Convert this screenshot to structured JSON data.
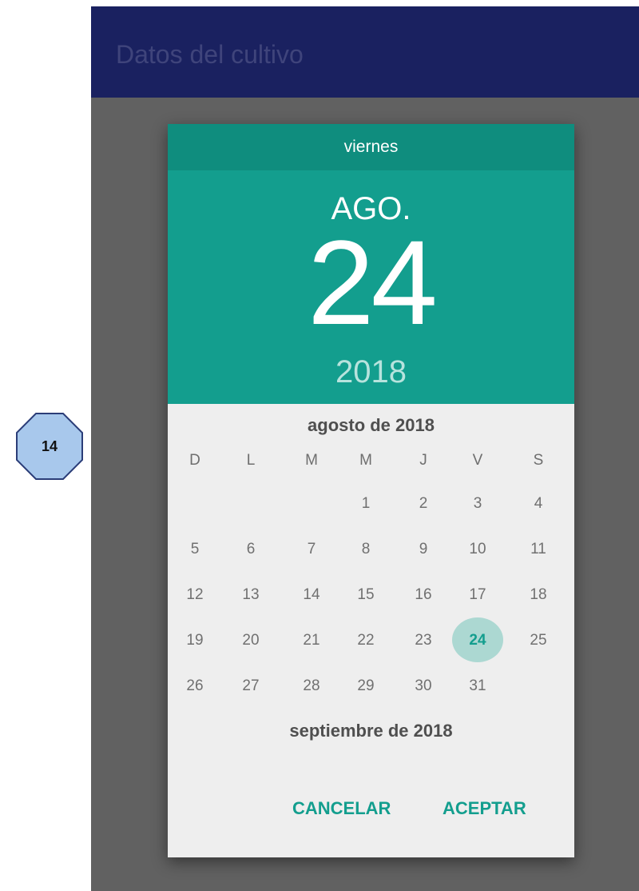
{
  "app": {
    "title": "Datos del cultivo"
  },
  "step_marker": {
    "label": "14"
  },
  "date_picker": {
    "weekday": "viernes",
    "month_short": "AGO.",
    "day": "24",
    "year": "2018",
    "month_title": "agosto de 2018",
    "weekday_headers": [
      "D",
      "L",
      "M",
      "M",
      "J",
      "V",
      "S"
    ],
    "weeks": [
      [
        "",
        "",
        "",
        "1",
        "2",
        "3",
        "4"
      ],
      [
        "5",
        "6",
        "7",
        "8",
        "9",
        "10",
        "11"
      ],
      [
        "12",
        "13",
        "14",
        "15",
        "16",
        "17",
        "18"
      ],
      [
        "19",
        "20",
        "21",
        "22",
        "23",
        "24",
        "25"
      ],
      [
        "26",
        "27",
        "28",
        "29",
        "30",
        "31",
        ""
      ]
    ],
    "selected_day": "24",
    "next_month_title": "septiembre de 2018",
    "cancel_label": "CANCELAR",
    "ok_label": "ACEPTAR"
  },
  "colors": {
    "appbar": "#1a2160",
    "header": "#139e8e",
    "header_weekday_bar": "#0f8d7e",
    "selected_circle": "#acd8d2",
    "accent": "#139e8e",
    "scrim": "#616161",
    "dialog_bg": "#eeeeee",
    "step_marker_fill": "#a8c8ec",
    "step_marker_border": "#2b3d78"
  }
}
